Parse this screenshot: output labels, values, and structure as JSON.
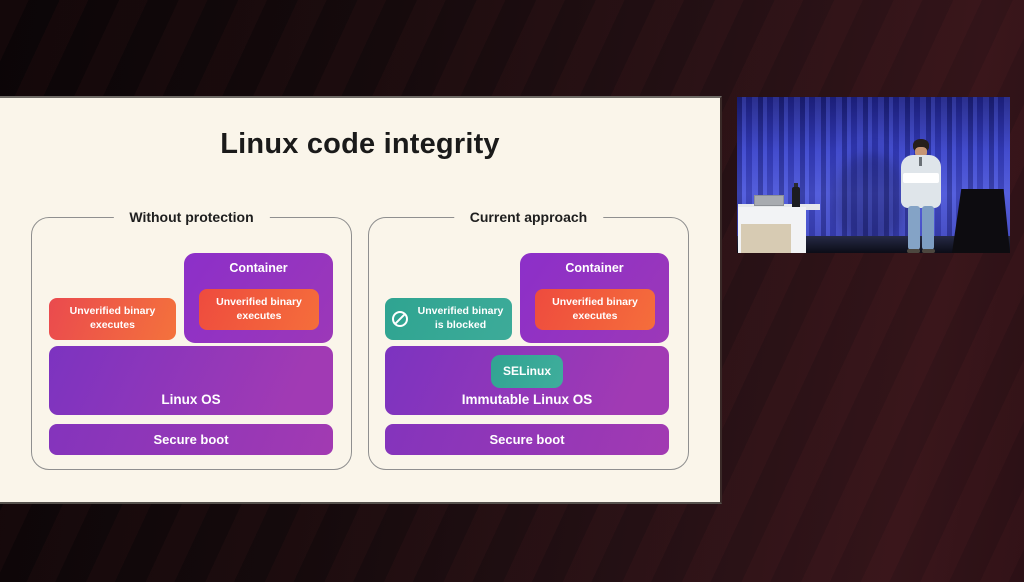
{
  "slide": {
    "title": "Linux code integrity",
    "without_protection": {
      "label": "Without protection",
      "unverified_binary": "Unverified binary executes",
      "container_label": "Container",
      "container_binary": "Unverified binary executes",
      "os_label": "Linux OS",
      "boot_label": "Secure boot"
    },
    "current_approach": {
      "label": "Current approach",
      "blocked_text": "Unverified binary is blocked",
      "container_label": "Container",
      "container_binary": "Unverified binary executes",
      "selinux_label": "SELinux",
      "os_label": "Immutable Linux OS",
      "boot_label": "Secure boot"
    }
  },
  "icons": {
    "blocked": "no-entry-circle-slash"
  },
  "colors": {
    "slide_background": "#faf5ea",
    "purple_box": "#8d34bf",
    "orange_box": "#f05a3a",
    "teal_box": "#35a794",
    "page_background": "#1d0b0f",
    "curtain_blue": "#4650cf"
  }
}
